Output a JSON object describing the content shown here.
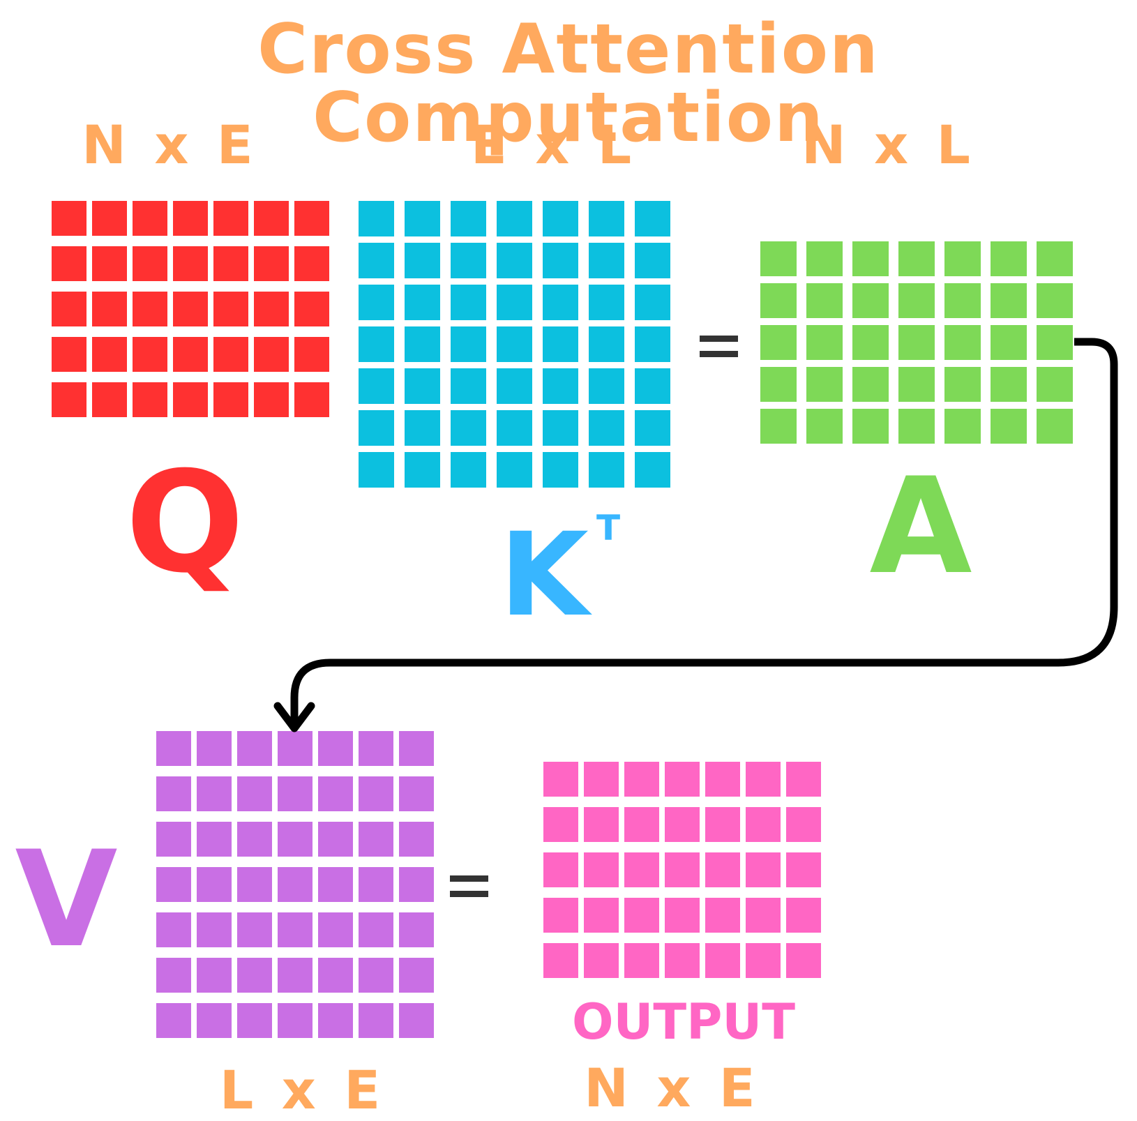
{
  "title": "Cross Attention Computation",
  "colors": {
    "title": "#FFA95E",
    "dims": "#FFA95E",
    "q": "#FF3131",
    "k": "#0CC0DF",
    "k_label": "#38B6FF",
    "a": "#7ED957",
    "v": "#C96FE4",
    "output": "#FF66C4",
    "equals": "#333333",
    "arrow": "#000000"
  },
  "q": {
    "dims": "N x E",
    "label": "Q",
    "rows": 5,
    "cols": 7
  },
  "k": {
    "dims": "E x L",
    "label": "K",
    "superscript": "T",
    "rows": 7,
    "cols": 7
  },
  "a": {
    "dims": "N x L",
    "label": "A",
    "rows": 5,
    "cols": 7
  },
  "v": {
    "dims": "L x E",
    "label": "V",
    "rows": 7,
    "cols": 7
  },
  "output": {
    "dims": "N x E",
    "label": "OUTPUT",
    "rows": 5,
    "cols": 7
  },
  "equals": "="
}
